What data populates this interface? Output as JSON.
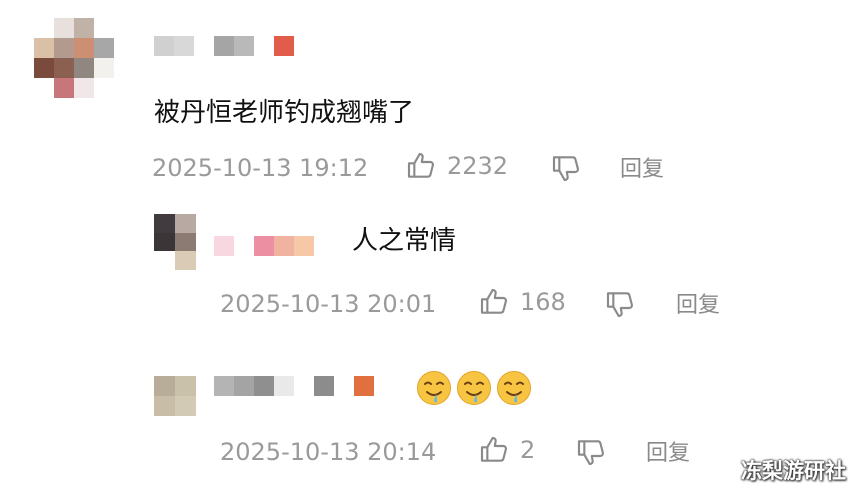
{
  "comments": [
    {
      "text": "被丹恒老师钓成翘嘴了",
      "timestamp": "2025-10-13 19:12",
      "likes": "2232",
      "reply_label": "回复",
      "avatar_colors": [
        "#ffffff",
        "#e7e0dc",
        "#c0b2a7",
        "#ffffff",
        "#d9c0a6",
        "#b29a8f",
        "#cc8f74",
        "#a7a7a7",
        "#7a4a3c",
        "#8c6050",
        "#8f8780",
        "#f3f1ee",
        "#ffffff",
        "#c7777a",
        "#efe7e8",
        "#ffffff"
      ],
      "name_colors": [
        "#d0d0d0",
        "#d8d8d8",
        "#ffffff",
        "#a5a5a5",
        "#b9b9b9",
        "#ffffff",
        "#e25c4c",
        "#ffffff"
      ]
    },
    {
      "text": "人之常情",
      "timestamp": "2025-10-13 20:01",
      "likes": "168",
      "reply_label": "回复",
      "avatar_colors": [
        "#413a3f",
        "#b9a9a3",
        "#3b3537",
        "#8b7b73",
        "#ffffff",
        "#d9cbb6"
      ],
      "name_colors": [
        "#f8d7e1",
        "#ffffff",
        "#ec8fa2",
        "#f0b3a0",
        "#f6c8a8"
      ]
    },
    {
      "text": "",
      "emojis": [
        "drooling-face-emoji",
        "drooling-face-emoji",
        "drooling-face-emoji"
      ],
      "timestamp": "2025-10-13 20:14",
      "likes": "2",
      "reply_label": "回复",
      "avatar_colors": [
        "#b7ad98",
        "#c9c1aa",
        "#c8bda6",
        "#d3cab5"
      ],
      "name_colors": [
        "#b4b4b4",
        "#a4a4a4",
        "#8f8f8f",
        "#e9e9e9",
        "#ffffff",
        "#8c8c8c",
        "#ffffff",
        "#e07040"
      ]
    }
  ],
  "watermark": "冻梨游研社"
}
